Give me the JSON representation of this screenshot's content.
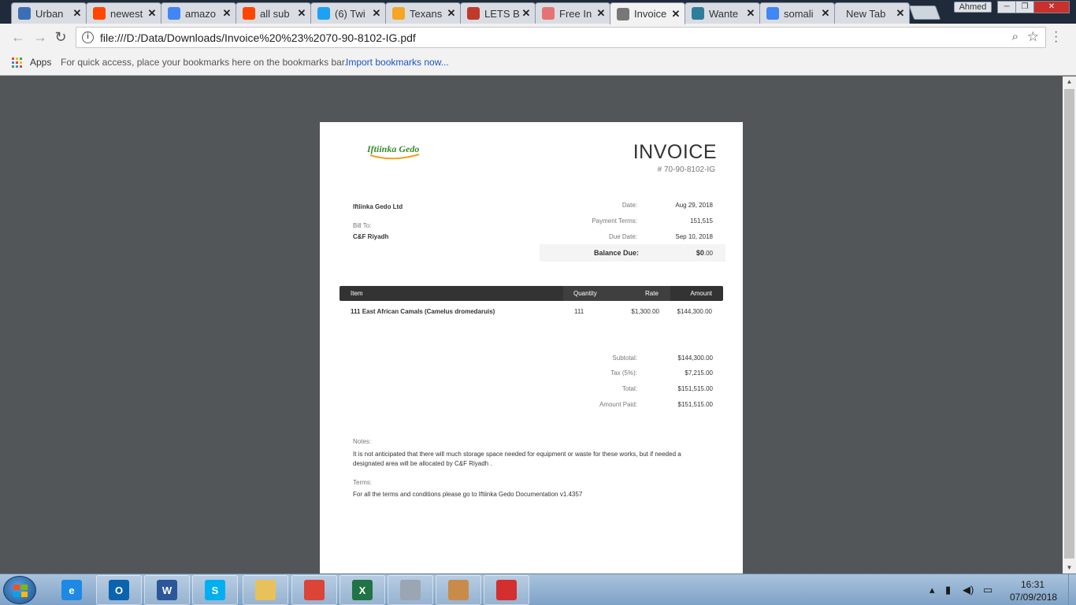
{
  "browser": {
    "tabs": [
      {
        "title": "Urban",
        "icon": "bookmark-blue-icon",
        "color": "#3a6fb7"
      },
      {
        "title": "newest",
        "icon": "reddit-icon",
        "color": "#ff4500"
      },
      {
        "title": "amazo",
        "icon": "google-icon",
        "color": "#4285f4"
      },
      {
        "title": "all sub",
        "icon": "reddit-icon",
        "color": "#ff4500"
      },
      {
        "title": "(6) Twi",
        "icon": "twitter-icon",
        "color": "#1da1f2"
      },
      {
        "title": "Texans",
        "icon": "spark-icon",
        "color": "#f5a623"
      },
      {
        "title": "LETS B",
        "icon": "record-icon",
        "color": "#c0392b"
      },
      {
        "title": "Free In",
        "icon": "zigzag-icon",
        "color": "#e57373"
      },
      {
        "title": "Invoice",
        "icon": "document-icon",
        "color": "#777777"
      },
      {
        "title": "Wante",
        "icon": "boat-icon",
        "color": "#2e7d9a"
      },
      {
        "title": "somali",
        "icon": "google-icon",
        "color": "#4285f4"
      },
      {
        "title": "New Tab",
        "icon": "",
        "color": ""
      }
    ],
    "close_glyph": "✕",
    "user": "Ahmed",
    "window": {
      "minimize": "─",
      "maximize": "❐",
      "close": "✕"
    },
    "url": "file:///D:/Data/Downloads/Invoice%20%23%2070-90-8102-IG.pdf",
    "bookmarks": {
      "apps_label": "Apps",
      "hint": "For quick access, place your bookmarks here on the bookmarks bar.",
      "import_link": "Import bookmarks now..."
    }
  },
  "invoice": {
    "logo_text": "Iftiinka Gedo",
    "title": "INVOICE",
    "number": "# 70-90-8102-IG",
    "company": "Iftiinka Gedo Ltd",
    "bill_to_label": "Bill To:",
    "bill_to": "C&F Riyadh",
    "meta": [
      {
        "label": "Date:",
        "value": "Aug 29, 2018"
      },
      {
        "label": "Payment Terms:",
        "value": "151,515"
      },
      {
        "label": "Due Date:",
        "value": "Sep 10, 2018"
      }
    ],
    "balance_label": "Balance Due:",
    "balance_value_main": "$0",
    "balance_value_cents": ".00",
    "table": {
      "headers": {
        "item": "Item",
        "quantity": "Quantity",
        "rate": "Rate",
        "amount": "Amount"
      },
      "rows": [
        {
          "item": "111 East African Camals (Camelus dromedaruis)",
          "quantity": "111",
          "rate": "$1,300.00",
          "amount": "$144,300.00"
        }
      ]
    },
    "totals": [
      {
        "label": "Subtotal:",
        "value": "$144,300.00"
      },
      {
        "label": "Tax (5%):",
        "value": "$7,215.00"
      },
      {
        "label": "Total:",
        "value": "$151,515.00"
      },
      {
        "label": "Amount Paid:",
        "value": "$151,515.00"
      }
    ],
    "notes_label": "Notes:",
    "notes": "It is not anticipated that there will much storage space needed for equipment or waste for these works, but if needed a designated area will be allocated by C&F Riyadh .",
    "terms_label": "Terms:",
    "terms": "For all the terms and conditions please go to Iftiinka Gedo Documentation v1.4357"
  },
  "taskbar": {
    "apps": [
      {
        "name": "internet-explorer-icon",
        "glyph": "e",
        "color": "#1e88e5"
      },
      {
        "name": "outlook-icon",
        "glyph": "O",
        "color": "#0a64ad"
      },
      {
        "name": "word-icon",
        "glyph": "W",
        "color": "#2b579a"
      },
      {
        "name": "skype-icon",
        "glyph": "S",
        "color": "#00aff0"
      },
      {
        "name": "file-explorer-icon",
        "glyph": "",
        "color": "#e8c15a"
      },
      {
        "name": "chrome-icon",
        "glyph": "",
        "color": "#db4437"
      },
      {
        "name": "excel-icon",
        "glyph": "X",
        "color": "#217346"
      },
      {
        "name": "calculator-icon",
        "glyph": "",
        "color": "#9aa6b2"
      },
      {
        "name": "paint-icon",
        "glyph": "",
        "color": "#c98b4a"
      },
      {
        "name": "acrobat-icon",
        "glyph": "",
        "color": "#d32f2f"
      }
    ],
    "time": "16:31",
    "date": "07/09/2018"
  }
}
